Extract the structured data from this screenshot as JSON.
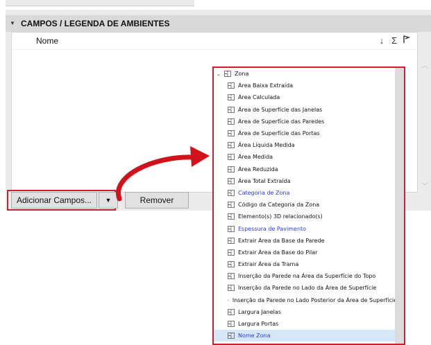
{
  "panel": {
    "title": "CAMPOS /  LEGENDA DE AMBIENTES",
    "list_header": {
      "name_label": "Nome",
      "sort_icon": "↓",
      "sum_icon": "Σ",
      "flag_icon": "flag-icon"
    }
  },
  "buttons": {
    "add_fields": "Adicionar Campos...",
    "add_dropdown": "▼",
    "remove": "Remover"
  },
  "dropdown": {
    "group_label": "Zona",
    "items": [
      {
        "label": "Área Baixa Extraída",
        "blue": false
      },
      {
        "label": "Área Calculada",
        "blue": false
      },
      {
        "label": "Área de Superfície das Janelas",
        "blue": false
      },
      {
        "label": "Área de Superfície das Paredes",
        "blue": false
      },
      {
        "label": "Área de Superfície das Portas",
        "blue": false
      },
      {
        "label": "Área Líquida Medida",
        "blue": false
      },
      {
        "label": "Área Medida",
        "blue": false
      },
      {
        "label": "Área Reduzida",
        "blue": false
      },
      {
        "label": "Área Total Extraída",
        "blue": false
      },
      {
        "label": "Categoria de Zona",
        "blue": true
      },
      {
        "label": "Código da Categoria da Zona",
        "blue": false
      },
      {
        "label": "Elemento(s) 3D relacionado(s)",
        "blue": false
      },
      {
        "label": "Espessura de Pavimento",
        "blue": true
      },
      {
        "label": "Extrair Área da Base da Parede",
        "blue": false
      },
      {
        "label": "Extrair Área da Base do Pilar",
        "blue": false
      },
      {
        "label": "Extrair Área da Trama",
        "blue": false
      },
      {
        "label": "Inserção da Parede na Área da Superfície do Topo",
        "blue": false
      },
      {
        "label": "Inserção da Parede no Lado da Área de Superfície",
        "blue": false
      },
      {
        "label": "Inserção da Parede no Lado Posterior da Área de Superfície",
        "blue": false
      },
      {
        "label": "Largura Janelas",
        "blue": false
      },
      {
        "label": "Largura Portas",
        "blue": false
      },
      {
        "label": "Nome Zona",
        "blue": true,
        "selected": true
      }
    ]
  },
  "colors": {
    "highlight_red": "#c8202e",
    "link_blue": "#2c3ec6",
    "panel_bg": "#ececec",
    "header_bg": "#d9d9d9"
  }
}
